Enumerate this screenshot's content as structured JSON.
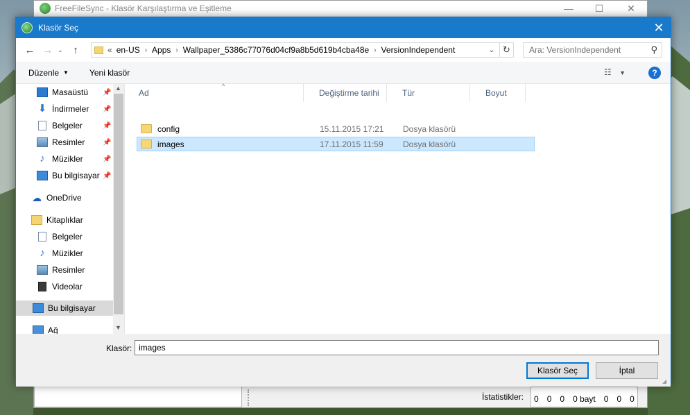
{
  "background_window": {
    "title": "FreeFileSync - Klasör Karşılaştırma ve Eşitleme",
    "controls": {
      "minimize": "—",
      "maximize": "☐",
      "close": "✕"
    },
    "statistics": {
      "label": "İstatistikler:",
      "values": [
        "0",
        "0",
        "0",
        "0 bayt",
        "0",
        "0",
        "0"
      ]
    }
  },
  "dialog": {
    "title": "Klasör Seç",
    "close": "✕",
    "address": {
      "overflow": "«",
      "crumbs": [
        "en-US",
        "Apps",
        "Wallpaper_5386c77076d04cf9a8b5d619b4cba48e",
        "VersionIndependent"
      ]
    },
    "search": {
      "placeholder": "Ara: VersionIndependent"
    },
    "toolbar": {
      "organize": "Düzenle",
      "new_folder": "Yeni klasör"
    },
    "sidebar": {
      "quick_access": [
        {
          "label": "Masaüstü",
          "icon": "desktop-icon"
        },
        {
          "label": "İndirmeler",
          "icon": "download-icon"
        },
        {
          "label": "Belgeler",
          "icon": "documents-icon"
        },
        {
          "label": "Resimler",
          "icon": "pictures-icon"
        },
        {
          "label": "Müzikler",
          "icon": "music-icon"
        },
        {
          "label": "Bu bilgisayar",
          "icon": "computer-icon"
        }
      ],
      "onedrive": "OneDrive",
      "libraries": {
        "label": "Kitaplıklar",
        "items": [
          "Belgeler",
          "Müzikler",
          "Resimler",
          "Videolar"
        ]
      },
      "this_pc": "Bu bilgisayar",
      "network": "Ağ"
    },
    "columns": {
      "name": "Ad",
      "modified": "Değiştirme tarihi",
      "type": "Tür",
      "size": "Boyut"
    },
    "files": [
      {
        "name": "config",
        "modified": "15.11.2015 17:21",
        "type": "Dosya klasörü",
        "selected": false
      },
      {
        "name": "images",
        "modified": "17.11.2015 11:59",
        "type": "Dosya klasörü",
        "selected": true
      }
    ],
    "folder_label": "Klasör:",
    "folder_value": "images",
    "buttons": {
      "ok": "Klasör Seç",
      "cancel": "İptal"
    },
    "accent_color": "#1979ca"
  }
}
